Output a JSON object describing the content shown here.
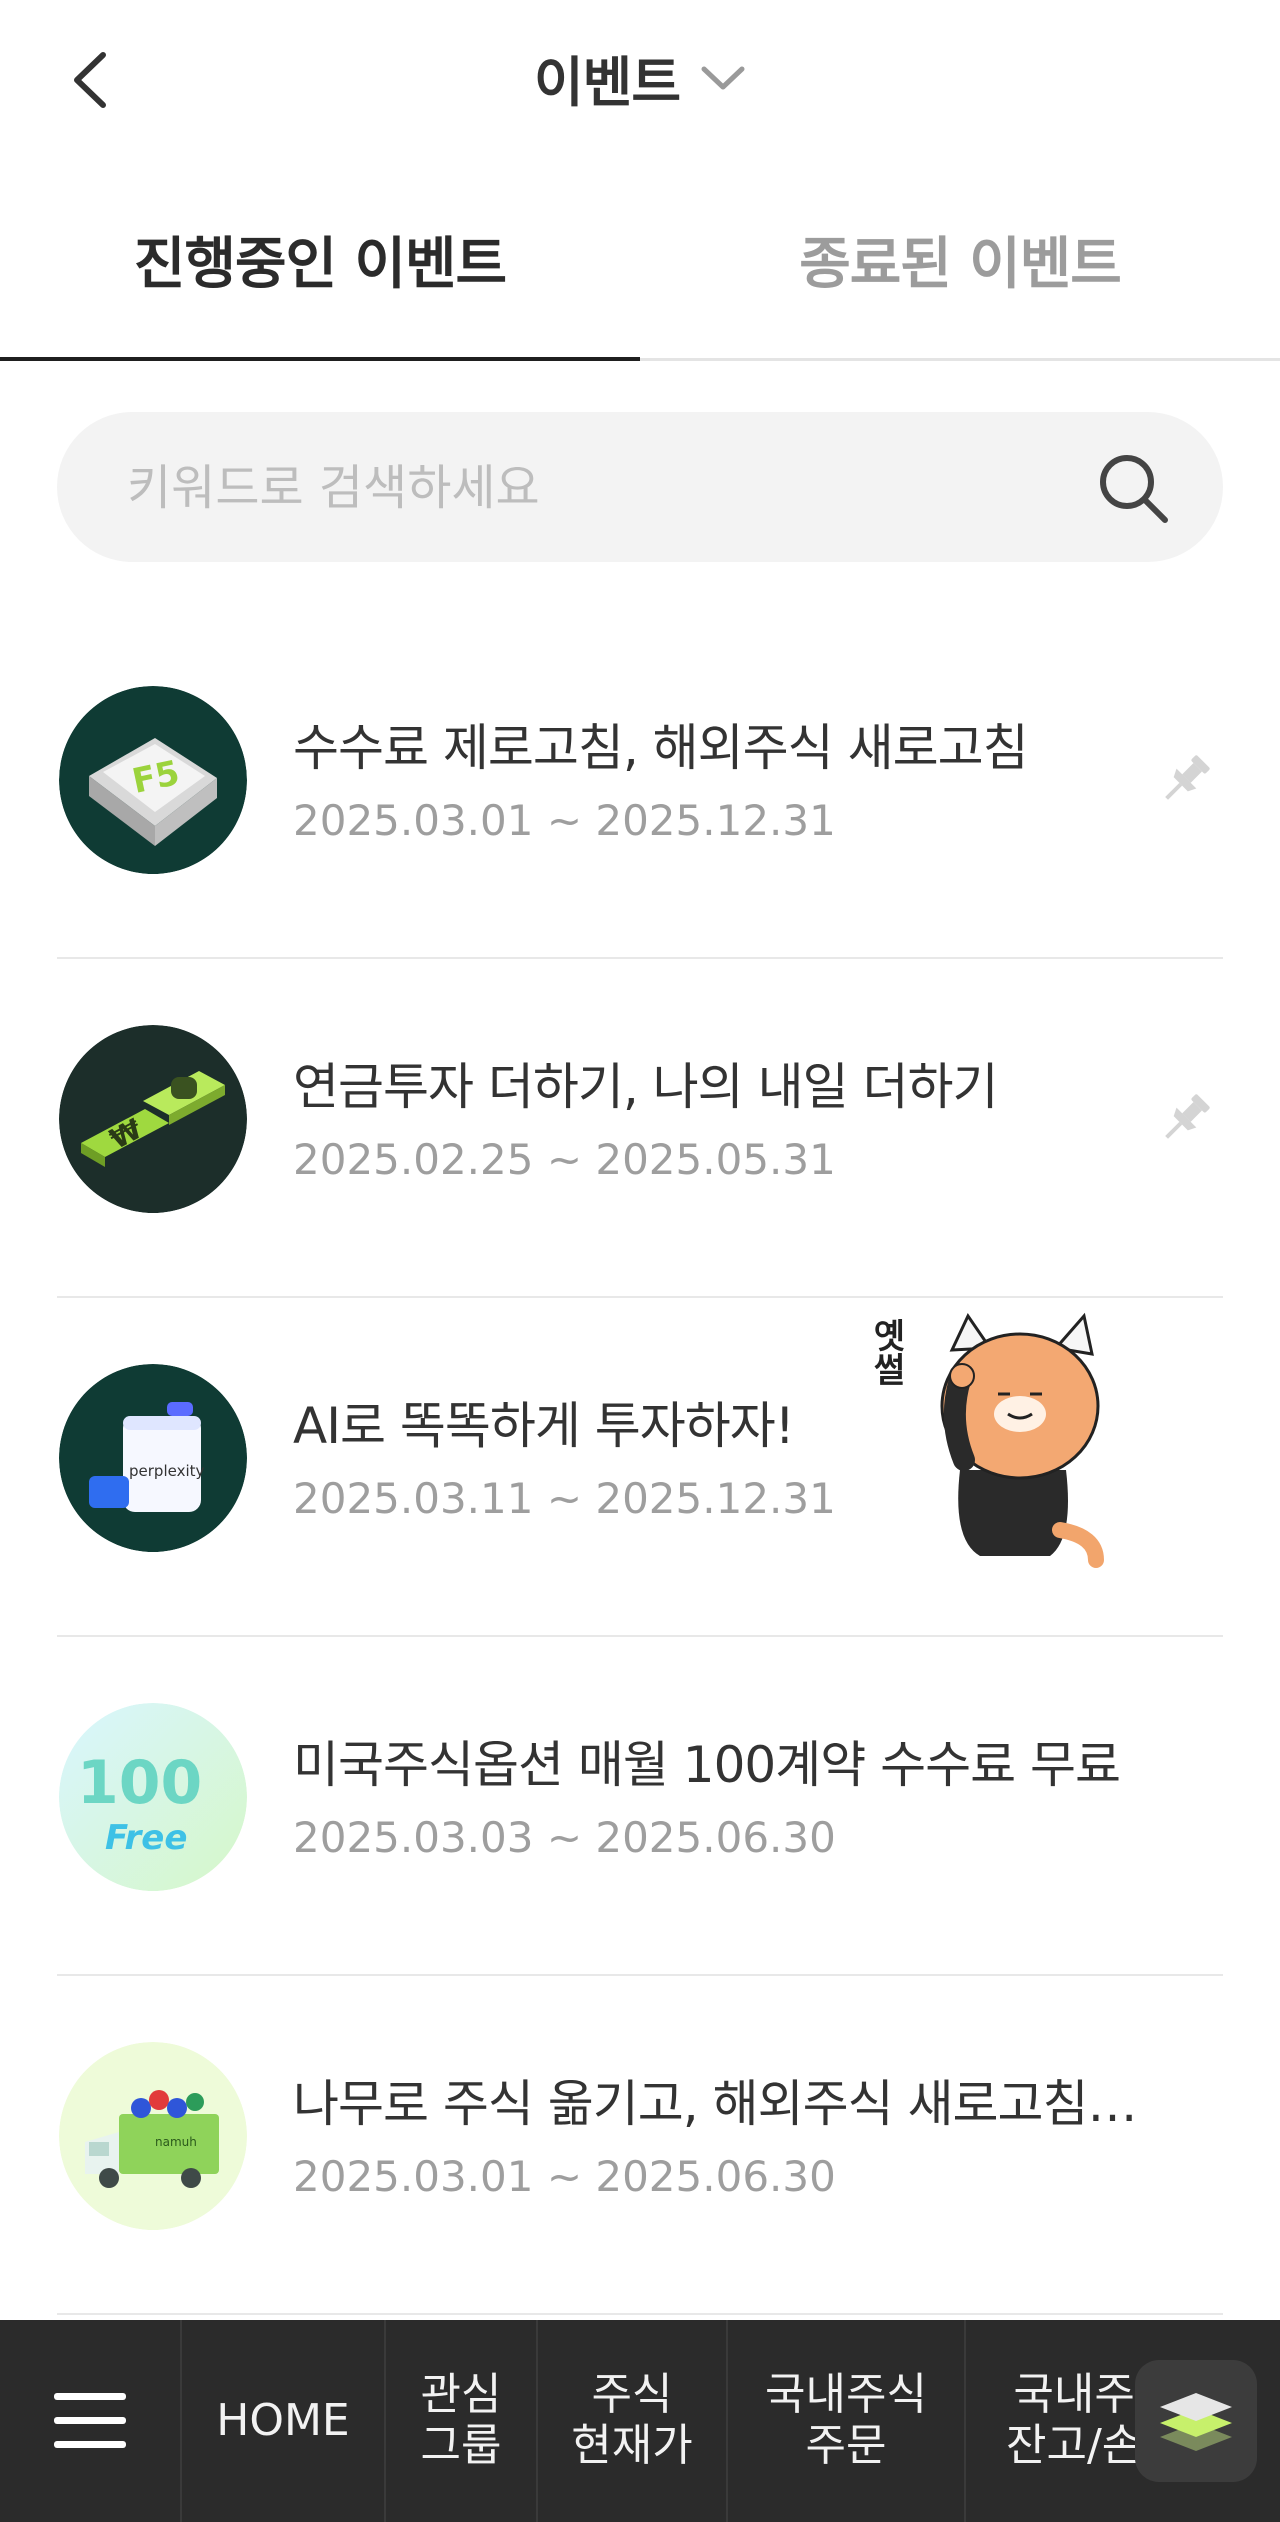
{
  "header": {
    "title": "이벤트",
    "back_icon": "chevron-left-icon",
    "dropdown_icon": "chevron-down-icon"
  },
  "tabs": [
    {
      "label": "진행중인 이벤트",
      "active": true
    },
    {
      "label": "종료된 이벤트",
      "active": false
    }
  ],
  "search": {
    "placeholder": "키워드로 검색하세요",
    "value": "",
    "icon": "search-icon"
  },
  "events": [
    {
      "title": "수수료 제로고침, 해외주식 새로고침",
      "period": "2025.03.01 ~ 2025.12.31",
      "pinned": true,
      "thumb_text": "F5",
      "thumb_icon": "keyboard-key-f5-icon"
    },
    {
      "title": "연금투자 더하기, 나의 내일 더하기",
      "period": "2025.02.25 ~ 2025.05.31",
      "pinned": true,
      "thumb_text": "₩",
      "thumb_icon": "puzzle-pieces-icon"
    },
    {
      "title": "AI로 똑똑하게 투자하자!",
      "period": "2025.03.11 ~ 2025.12.31",
      "pinned": false,
      "thumb_text": "perplexity",
      "thumb_icon": "perplexity-box-icon"
    },
    {
      "title": "미국주식옵션 매월 100계약 수수료 무료",
      "period": "2025.03.03 ~ 2025.06.30",
      "pinned": false,
      "thumb_text": "100 Free",
      "thumb_icon": "100-free-badge-icon"
    },
    {
      "title": "나무로 주식 옮기고, 해외주식 새로고침…",
      "period": "2025.03.01 ~ 2025.06.30",
      "pinned": false,
      "thumb_text": "namuh",
      "thumb_icon": "delivery-truck-icon"
    }
  ],
  "sticker": {
    "caption": "옛썰",
    "icon": "saluting-cat-sticker"
  },
  "bottom_nav": {
    "menu_icon": "hamburger-menu-icon",
    "items": [
      {
        "label": "HOME"
      },
      {
        "label": "관심\n그룹"
      },
      {
        "label": "주식\n현재가"
      },
      {
        "label": "국내주식\n주문"
      },
      {
        "label": "국내주식\n잔고/손익"
      }
    ],
    "fab_icon": "layers-icon"
  },
  "colors": {
    "accent": "#a6e24a",
    "nav_bg": "#2b2b2b",
    "thumb_dark": "#0f3b34"
  }
}
